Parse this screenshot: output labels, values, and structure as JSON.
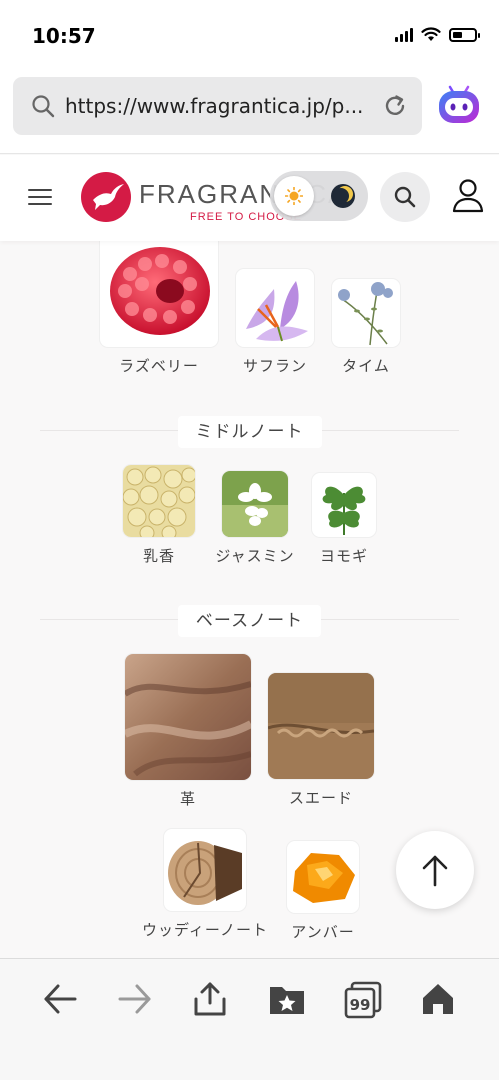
{
  "status_bar": {
    "time": "10:57"
  },
  "browser": {
    "url": "https://www.fragrantica.jp/p...",
    "search_icon": "search-icon",
    "reload_icon": "reload-icon",
    "assistant_icon": "assistant-robot-icon"
  },
  "site_header": {
    "logo_text": "FRAGRANTICA",
    "tagline": "FREE TO CHOOSE",
    "brand_color": "#d41b45"
  },
  "notes": {
    "top": [
      {
        "label": "ラズベリー",
        "icon": "raspberry"
      },
      {
        "label": "サフラン",
        "icon": "saffron"
      },
      {
        "label": "タイム",
        "icon": "thyme"
      }
    ],
    "middle_title": "ミドルノート",
    "middle": [
      {
        "label": "乳香",
        "icon": "frankincense"
      },
      {
        "label": "ジャスミン",
        "icon": "jasmine"
      },
      {
        "label": "ヨモギ",
        "icon": "mugwort"
      }
    ],
    "base_title": "ベースノート",
    "base": [
      {
        "label": "革",
        "icon": "leather"
      },
      {
        "label": "スエード",
        "icon": "suede"
      },
      {
        "label": "ウッディーノート",
        "icon": "woody-notes"
      },
      {
        "label": "アンバー",
        "icon": "amber"
      }
    ]
  }
}
